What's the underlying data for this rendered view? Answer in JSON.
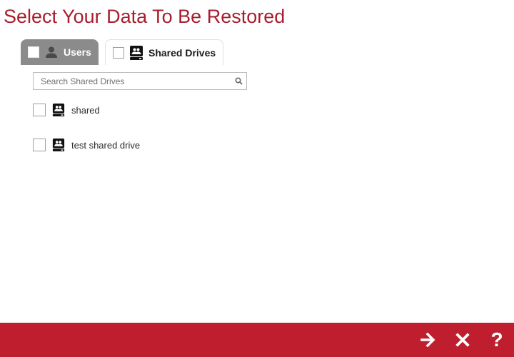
{
  "page": {
    "title": "Select Your Data To Be Restored"
  },
  "tabs": [
    {
      "label": "Users",
      "icon": "user-icon",
      "active": false,
      "checked": false
    },
    {
      "label": "Shared Drives",
      "icon": "shared-drive-icon",
      "active": true,
      "checked": false
    }
  ],
  "search": {
    "placeholder": "Search Shared Drives",
    "value": ""
  },
  "drives": [
    {
      "label": "shared",
      "icon": "shared-drive-icon",
      "checked": false
    },
    {
      "label": "test shared drive",
      "icon": "shared-drive-icon",
      "checked": false
    }
  ],
  "footer": {
    "next_icon": "arrow-right-icon",
    "close_icon": "close-icon",
    "help_label": "?"
  },
  "colors": {
    "title": "#a91d2e",
    "footer": "#be1e2d",
    "inactive_tab": "#8b8b8b"
  }
}
